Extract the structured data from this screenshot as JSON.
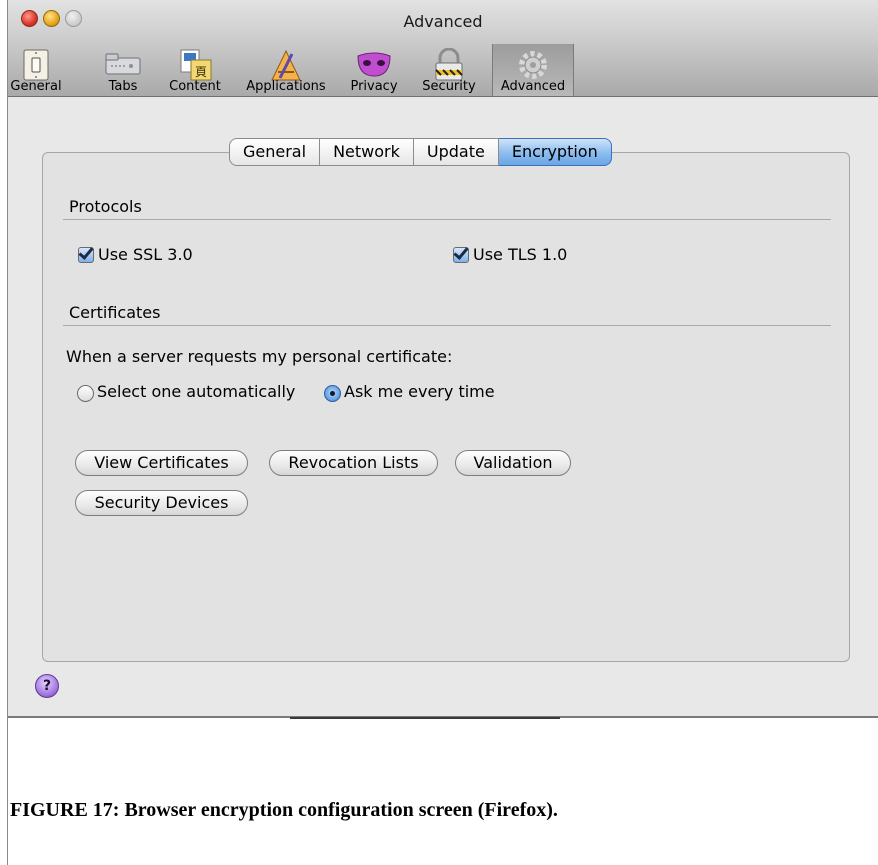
{
  "window": {
    "title": "Advanced"
  },
  "toolbar": {
    "items": [
      {
        "label": "General",
        "icon": "light-switch-icon"
      },
      {
        "label": "Tabs",
        "icon": "tabs-icon"
      },
      {
        "label": "Content",
        "icon": "content-documents-icon"
      },
      {
        "label": "Applications",
        "icon": "applications-icon"
      },
      {
        "label": "Privacy",
        "icon": "privacy-mask-icon"
      },
      {
        "label": "Security",
        "icon": "padlock-icon"
      },
      {
        "label": "Advanced",
        "icon": "gear-icon",
        "selected": true
      }
    ]
  },
  "tabs": [
    {
      "label": "General"
    },
    {
      "label": "Network"
    },
    {
      "label": "Update"
    },
    {
      "label": "Encryption",
      "active": true
    }
  ],
  "protocols": {
    "heading": "Protocols",
    "ssl_label": "Use SSL 3.0",
    "ssl_checked": true,
    "tls_label": "Use TLS 1.0",
    "tls_checked": true
  },
  "certificates": {
    "heading": "Certificates",
    "request_prompt": "When a server requests my personal certificate:",
    "option_auto": "Select one automatically",
    "option_ask": "Ask me every time",
    "selected_option": "Ask me every time",
    "buttons": {
      "view": "View Certificates",
      "revocation": "Revocation Lists",
      "validation": "Validation",
      "devices": "Security Devices"
    }
  },
  "help": {
    "symbol": "?"
  },
  "caption": "FIGURE 17: Browser encryption configuration screen (Firefox).",
  "colors": {
    "active_tab": "#8bbcef",
    "help_button": "#a57be0",
    "close_button": "#d9362b",
    "minimize_button": "#e6a51b"
  }
}
